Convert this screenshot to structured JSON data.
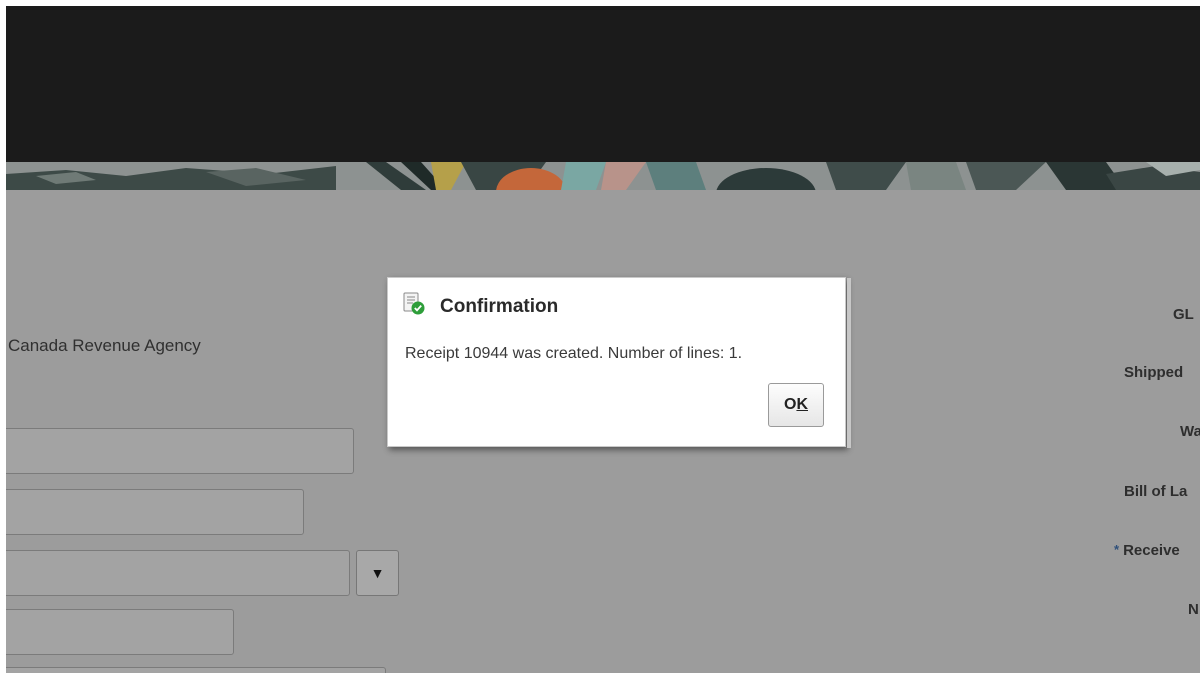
{
  "colors": {
    "topbar": "#1b1b1b",
    "overlay_background": "#9c9c9c",
    "dialog_background": "#ffffff",
    "confirm_icon_green": "#2e9e3a"
  },
  "form": {
    "left_label": "Canada Revenue Agency",
    "select_arrow_icon": "dropdown-arrow-icon",
    "right_labels": {
      "gl": "GL",
      "shipped": "Shipped",
      "wa": "Wa",
      "bill_of_lading": "Bill of La",
      "receive": "Receive",
      "n": "N"
    },
    "required_marker": "*"
  },
  "dialog": {
    "icon": "confirmation-check-icon",
    "title": "Confirmation",
    "message": "Receipt 10944 was created. Number of lines: 1.",
    "ok_label": "O",
    "ok_mnemonic": "K"
  }
}
